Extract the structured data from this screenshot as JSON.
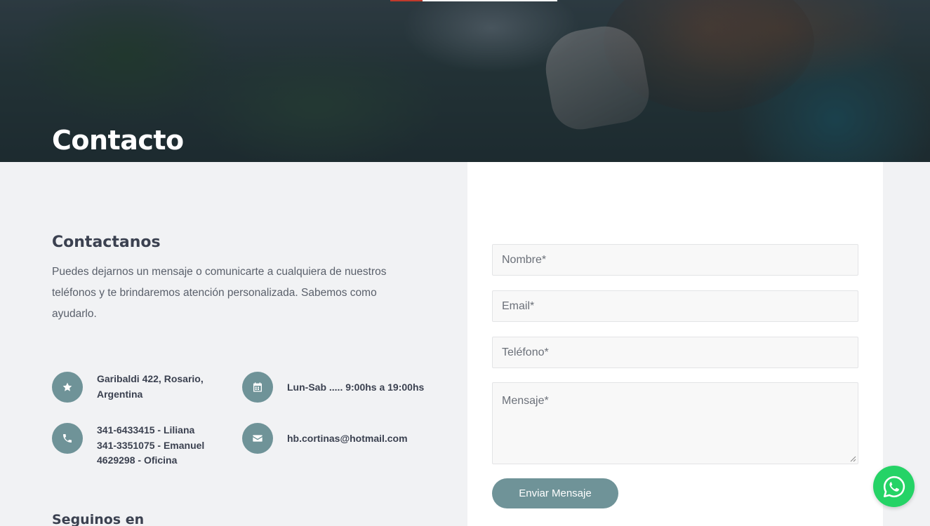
{
  "hero": {
    "title": "Contacto"
  },
  "contact": {
    "heading": "Contactanos",
    "intro": "Puedes dejarnos un mensaje o comunicarte a cualquiera de nuestros teléfonos y te brindaremos atención personalizada. Sabemos como ayudarlo.",
    "address_line1": "Garibaldi 422, Rosario,",
    "address_line2": "Argentina",
    "hours": "Lun-Sab ..... 9:00hs a 19:00hs",
    "phone_line1": "341-6433415 - Liliana",
    "phone_line2": "341-3351075 - Emanuel",
    "phone_line3": "4629298 - Oficina",
    "email": "hb.cortinas@hotmail.com",
    "follow_heading": "Seguinos en"
  },
  "form": {
    "name_placeholder": "Nombre*",
    "email_placeholder": "Email*",
    "phone_placeholder": "Teléfono*",
    "message_placeholder": "Mensaje*",
    "submit_label": "Enviar Mensaje"
  },
  "icons": {
    "address": "star-icon",
    "hours": "calendar-icon",
    "phone": "phone-icon",
    "email": "envelope-icon",
    "chat": "whatsapp-icon"
  },
  "colors": {
    "accent": "#6f9398",
    "whatsapp": "#25d366",
    "text_dark": "#3b4150"
  }
}
